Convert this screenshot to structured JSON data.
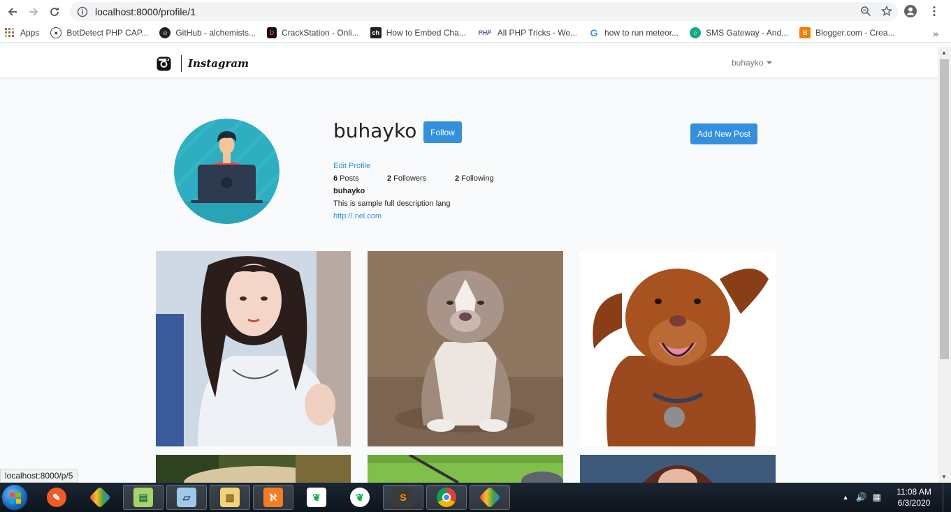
{
  "browser": {
    "url": "localhost:8000/profile/1",
    "bookmarks": [
      {
        "label": "Apps",
        "icon": "apps-grid-icon"
      },
      {
        "label": "BotDetect PHP CAP...",
        "icon": "botdetect-icon"
      },
      {
        "label": "GitHub - alchemists...",
        "icon": "github-icon"
      },
      {
        "label": "CrackStation - Onli...",
        "icon": "crackstation-icon"
      },
      {
        "label": "How to Embed Cha...",
        "icon": "ch-icon"
      },
      {
        "label": "All PHP Tricks - We...",
        "icon": "php-icon"
      },
      {
        "label": "how to run meteor...",
        "icon": "google-icon"
      },
      {
        "label": "SMS Gateway - And...",
        "icon": "sms-icon"
      },
      {
        "label": "Blogger.com - Crea...",
        "icon": "blogger-icon"
      }
    ],
    "status_url": "localhost:8000/p/5"
  },
  "app": {
    "brand": "Instagram",
    "user_menu": "buhayko"
  },
  "profile": {
    "username": "buhayko",
    "follow_label": "Follow",
    "add_post_label": "Add New Post",
    "edit_label": "Edit Profile",
    "posts_count": "6",
    "posts_label": "Posts",
    "followers_count": "2",
    "followers_label": "Followers",
    "following_count": "2",
    "following_label": "Following",
    "title": "buhayko",
    "description": "This is sample full description lang",
    "url": "http://.nel.com"
  },
  "taskbar": {
    "time": "11:08 AM",
    "date": "6/3/2020"
  }
}
